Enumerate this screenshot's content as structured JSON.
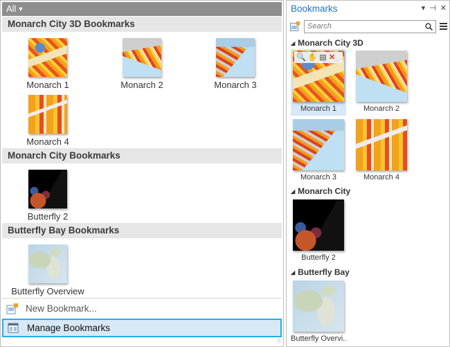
{
  "gallery": {
    "filter_label": "All",
    "groups": [
      {
        "title": "Monarch City 3D Bookmarks",
        "items": [
          {
            "label": "Monarch 1"
          },
          {
            "label": "Monarch 2"
          },
          {
            "label": "Monarch 3"
          },
          {
            "label": "Monarch 4"
          }
        ]
      },
      {
        "title": "Monarch City Bookmarks",
        "items": [
          {
            "label": "Butterfly 2"
          }
        ]
      },
      {
        "title": "Butterfly Bay Bookmarks",
        "items": [
          {
            "label": "Butterfly Overview"
          }
        ]
      }
    ],
    "commands": {
      "new_label": "New Bookmark...",
      "manage_label": "Manage Bookmarks"
    }
  },
  "pane": {
    "title": "Bookmarks",
    "search_placeholder": "Search",
    "groups": [
      {
        "title": "Monarch City 3D",
        "items": [
          {
            "label": "Monarch 1"
          },
          {
            "label": "Monarch 2"
          },
          {
            "label": "Monarch 3"
          },
          {
            "label": "Monarch 4"
          }
        ]
      },
      {
        "title": "Monarch City",
        "items": [
          {
            "label": "Butterfly 2"
          }
        ]
      },
      {
        "title": "Butterfly Bay",
        "items": [
          {
            "label": "Butterfly Overvi..."
          }
        ]
      }
    ]
  },
  "colors": {
    "accent": "#1FB0E8",
    "selection": "#D7E8F6",
    "title_blue": "#1E75C4",
    "header_gray": "#8E8E8E"
  }
}
